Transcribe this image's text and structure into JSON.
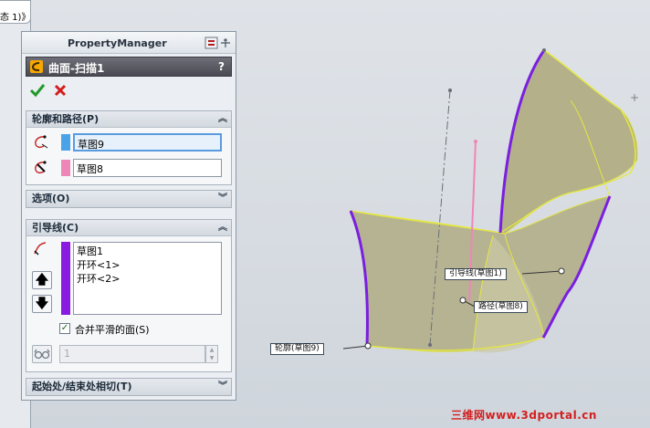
{
  "tree": {
    "crumb": "态 1)》"
  },
  "property_manager": {
    "title": "PropertyManager",
    "feature_title": "曲面-扫描1",
    "help": "?",
    "ok_icon": "check-icon",
    "cancel_icon": "x-icon",
    "groups": {
      "profile_path": {
        "label": "轮廓和路径(P)",
        "profile": {
          "value": "草图9",
          "color": "#4aa3e8"
        },
        "path": {
          "value": "草图8",
          "color": "#ef86b8"
        }
      },
      "options": {
        "label": "选项(O)"
      },
      "guides": {
        "label": "引导线(C)",
        "color": "#8a1be0",
        "items": [
          "草图1",
          "开环<1>",
          "开环<2>"
        ],
        "merge_label": "合并平滑的面(S)",
        "merge_checked": true,
        "count_value": "1"
      },
      "tangency": {
        "label": "起始处/结束处相切(T)"
      }
    }
  },
  "viewport": {
    "callouts": {
      "guide": "引导线(草图1)",
      "path": "路径(草图8)",
      "profile": "轮廓(草图9)"
    },
    "watermark": "三维网www.3dportal.cn"
  }
}
